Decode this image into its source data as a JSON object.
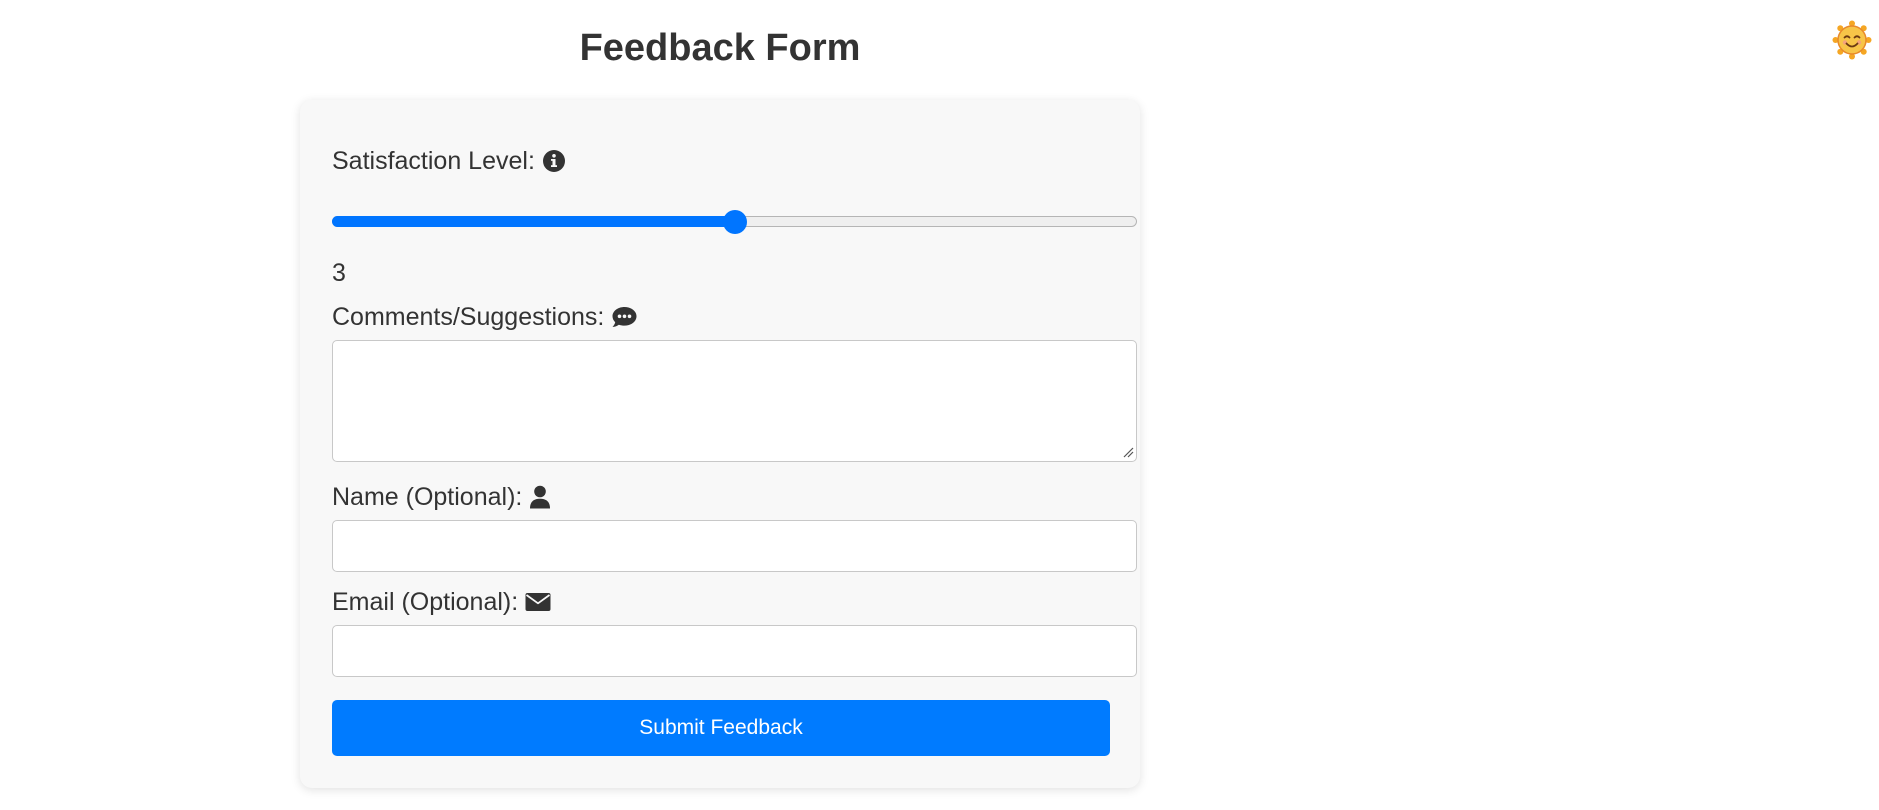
{
  "page": {
    "title": "Feedback Form",
    "theme_toggle_icon": "smiling-sun-icon"
  },
  "form": {
    "satisfaction": {
      "label": "Satisfaction Level:",
      "icon": "info-circle-icon",
      "min": 1,
      "max": 5,
      "value": 3,
      "value_display": "3"
    },
    "comments": {
      "label": "Comments/Suggestions:",
      "icon": "comment-dots-icon",
      "value": ""
    },
    "name": {
      "label": "Name (Optional):",
      "icon": "user-icon",
      "value": ""
    },
    "email": {
      "label": "Email (Optional):",
      "icon": "envelope-icon",
      "value": ""
    },
    "submit_label": "Submit Feedback"
  },
  "colors": {
    "accent": "#007bff",
    "slider_accent": "#0075ff",
    "card_background": "#f8f8f8",
    "text": "#333333"
  }
}
